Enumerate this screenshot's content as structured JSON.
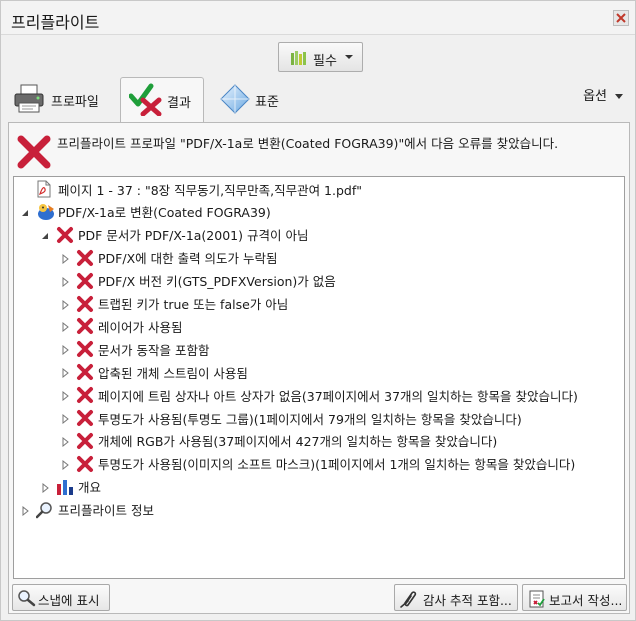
{
  "window": {
    "title": "프리플라이트"
  },
  "toolbar": {
    "essential_label": "필수"
  },
  "tabs": [
    {
      "label": "프로파일",
      "icon": "printer-icon"
    },
    {
      "label": "결과",
      "icon": "check-cross-icon",
      "selected": true
    },
    {
      "label": "표준",
      "icon": "diamond-icon"
    }
  ],
  "options_label": "옵션",
  "summary": {
    "message": "프리플라이트 프로파일 \"PDF/X-1a로 변환(Coated FOGRA39)\"에서 다음 오류를 찾았습니다."
  },
  "tree": {
    "rows": [
      {
        "text": "페이지 1 - 37 : \"8장 직무동기,직무만족,직무관여 1.pdf\"",
        "level": 0,
        "expander": "none",
        "icon": "pdf-file-icon"
      },
      {
        "text": "PDF/X-1a로 변환(Coated FOGRA39)",
        "level": 0,
        "expander": "expanded",
        "icon": "profile-icon"
      },
      {
        "text": "PDF 문서가 PDF/X-1a(2001) 규격이 아님",
        "level": 1,
        "expander": "expanded",
        "icon": "error-x-icon"
      },
      {
        "text": "PDF/X에 대한 출력 의도가 누락됨",
        "level": 2,
        "expander": "collapsed",
        "icon": "error-x-icon"
      },
      {
        "text": "PDF/X 버전 키(GTS_PDFXVersion)가 없음",
        "level": 2,
        "expander": "collapsed",
        "icon": "error-x-icon"
      },
      {
        "text": "트랩된 키가 true 또는 false가 아님",
        "level": 2,
        "expander": "collapsed",
        "icon": "error-x-icon"
      },
      {
        "text": "레이어가 사용됨",
        "level": 2,
        "expander": "collapsed",
        "icon": "error-x-icon"
      },
      {
        "text": "문서가 동작을 포함함",
        "level": 2,
        "expander": "collapsed",
        "icon": "error-x-icon"
      },
      {
        "text": "압축된 개체 스트림이 사용됨",
        "level": 2,
        "expander": "collapsed",
        "icon": "error-x-icon"
      },
      {
        "text": "페이지에 트림 상자나 아트 상자가 없음(37페이지에서 37개의 일치하는 항목을 찾았습니다)",
        "level": 2,
        "expander": "collapsed",
        "icon": "error-x-icon"
      },
      {
        "text": "투명도가 사용됨(투명도 그룹)(1페이지에서 79개의 일치하는 항목을 찾았습니다)",
        "level": 2,
        "expander": "collapsed",
        "icon": "error-x-icon"
      },
      {
        "text": "개체에 RGB가 사용됨(37페이지에서 427개의 일치하는 항목을 찾았습니다)",
        "level": 2,
        "expander": "collapsed",
        "icon": "error-x-icon"
      },
      {
        "text": "투명도가 사용됨(이미지의 소프트 마스크)(1페이지에서 1개의 일치하는 항목을 찾았습니다)",
        "level": 2,
        "expander": "collapsed",
        "icon": "error-x-icon"
      },
      {
        "text": "개요",
        "level": 1,
        "expander": "collapsed",
        "icon": "overview-chart-icon"
      },
      {
        "text": "프리플라이트 정보",
        "level": 0,
        "expander": "collapsed",
        "icon": "magnifier-icon"
      }
    ]
  },
  "buttons": {
    "snap_label": "스냅에 표시",
    "audit_label": "감사 추적 포함...",
    "report_label": "보고서 작성..."
  },
  "colors": {
    "error_red": "#c8203a",
    "check_green": "#1f9e3a",
    "accent_blue": "#2f6fd0"
  }
}
